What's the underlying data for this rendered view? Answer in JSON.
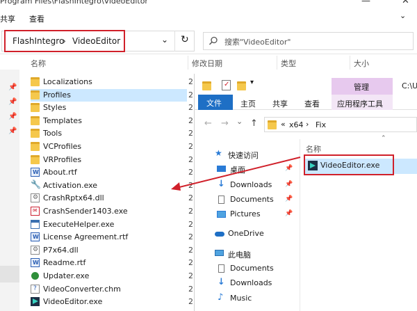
{
  "title_bar": {
    "path_text": "Program Files\\FlashIntegro\\VideoEditor",
    "minimize": "—",
    "close": "✕"
  },
  "menu": {
    "share": "共享",
    "view": "查看",
    "expand": "⌄"
  },
  "address": {
    "crumbs": [
      "FlashIntegro",
      "›",
      "VideoEditor"
    ],
    "dropdown": "⌄",
    "refresh": "↻"
  },
  "search": {
    "placeholder": "搜索\"VideoEditor\"",
    "icon": "search-icon"
  },
  "columns": {
    "name": "名称",
    "modified": "修改日期",
    "type": "类型",
    "size": "大小"
  },
  "left_pins": [
    "📌",
    "📌",
    "📌",
    "📌"
  ],
  "files": [
    {
      "label": "Localizations",
      "icon": "folder",
      "date": "2"
    },
    {
      "label": "Profiles",
      "icon": "folder",
      "date": "2",
      "selected": true
    },
    {
      "label": "Styles",
      "icon": "folder",
      "date": "2"
    },
    {
      "label": "Templates",
      "icon": "folder",
      "date": "2"
    },
    {
      "label": "Tools",
      "icon": "folder",
      "date": "2"
    },
    {
      "label": "VCProfiles",
      "icon": "folder",
      "date": "2"
    },
    {
      "label": "VRProfiles",
      "icon": "folder",
      "date": "2"
    },
    {
      "label": "About.rtf",
      "icon": "rtf",
      "date": "2"
    },
    {
      "label": "Activation.exe",
      "icon": "tool",
      "date": "2"
    },
    {
      "label": "CrashRptx64.dll",
      "icon": "dll",
      "date": "2"
    },
    {
      "label": "CrashSender1403.exe",
      "icon": "crash",
      "date": "2"
    },
    {
      "label": "ExecuteHelper.exe",
      "icon": "exe",
      "date": "2"
    },
    {
      "label": "License Agreement.rtf",
      "icon": "rtf",
      "date": "2"
    },
    {
      "label": "P7x64.dll",
      "icon": "dll",
      "date": "2"
    },
    {
      "label": "Readme.rtf",
      "icon": "rtf",
      "date": "2"
    },
    {
      "label": "Updater.exe",
      "icon": "updater",
      "date": "2"
    },
    {
      "label": "VideoConverter.chm",
      "icon": "chm",
      "date": "2"
    },
    {
      "label": "VideoEditor.exe",
      "icon": "app",
      "date": "2"
    }
  ],
  "overlay": {
    "ribbon_right_text": "C:\\U",
    "tabs": {
      "file": "文件",
      "home": "主页",
      "share": "共享",
      "view": "查看",
      "manage": "管理",
      "app_tools": "应用程序工具"
    },
    "nav": {
      "back": "←",
      "forward": "→",
      "recent": "⌄",
      "up": "↑"
    },
    "path": [
      "«",
      "x64",
      "›",
      "Fix"
    ],
    "tree": [
      {
        "label": "快速访问",
        "icon": "star",
        "top": true
      },
      {
        "label": "桌面",
        "icon": "desktop",
        "pin": true
      },
      {
        "label": "Downloads",
        "icon": "download",
        "pin": true
      },
      {
        "label": "Documents",
        "icon": "document",
        "pin": true
      },
      {
        "label": "Pictures",
        "icon": "picture",
        "pin": true
      },
      {
        "label": "OneDrive",
        "icon": "cloud",
        "top": true
      },
      {
        "label": "此电脑",
        "icon": "computer",
        "top": true
      },
      {
        "label": "Documents",
        "icon": "document"
      },
      {
        "label": "Downloads",
        "icon": "download"
      },
      {
        "label": "Music",
        "icon": "music"
      }
    ],
    "right_header": "名称",
    "right_file": "VideoEditor.exe"
  },
  "colors": {
    "selection": "#cce8ff",
    "highlight_red": "#d0202a",
    "file_tab_blue": "#1e6fc5",
    "manage_purple": "#e7c9ee"
  }
}
